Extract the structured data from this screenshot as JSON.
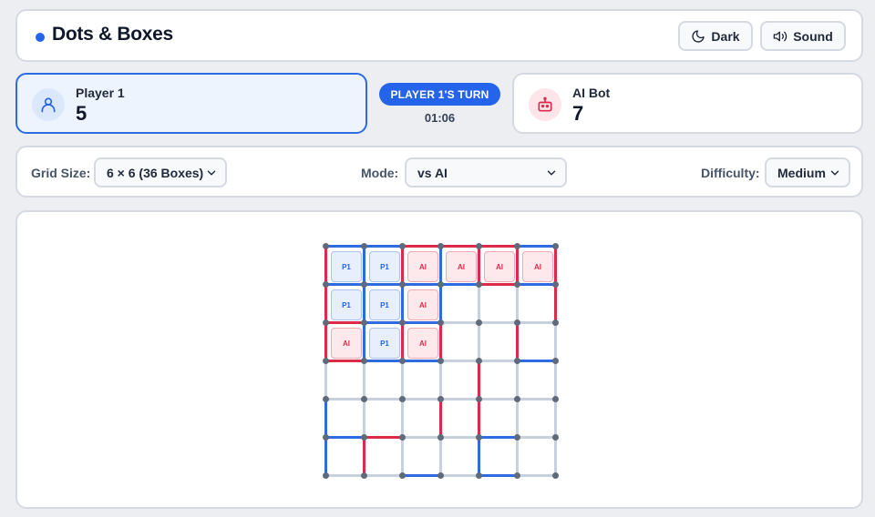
{
  "header": {
    "title": "Dots & Boxes",
    "dark_label": "Dark",
    "sound_label": "Sound"
  },
  "players": {
    "p1": {
      "name": "Player 1",
      "score": "5",
      "icon": "user-icon"
    },
    "p2": {
      "name": "AI Bot",
      "score": "7",
      "icon": "robot-icon"
    }
  },
  "turn": {
    "label": "PLAYER 1'S TURN",
    "timer": "01:06"
  },
  "settings": {
    "grid_size_label": "Grid Size:",
    "grid_size_value": "6 × 6 (36 Boxes)",
    "mode_label": "Mode:",
    "mode_value": "vs AI",
    "difficulty_label": "Difficulty:",
    "difficulty_value": "Medium"
  },
  "colors": {
    "player1": "#2f6be0",
    "ai": "#dd2a48",
    "empty": "#c7d0dc",
    "accent": "#2563eb"
  },
  "board": {
    "size": 6,
    "boxes": [
      [
        "P1",
        "P1",
        "AI",
        "AI",
        "AI",
        "AI"
      ],
      [
        "P1",
        "P1",
        "AI",
        "",
        "",
        ""
      ],
      [
        "AI",
        "P1",
        "AI",
        "",
        "",
        ""
      ],
      [
        "",
        "",
        "",
        "",
        "",
        ""
      ],
      [
        "",
        "",
        "",
        "",
        "",
        ""
      ],
      [
        "",
        "",
        "",
        "",
        "",
        ""
      ]
    ],
    "h_lines": [
      [
        "p1",
        "p1",
        "ai",
        "ai",
        "ai",
        "p1"
      ],
      [
        "p1",
        "p1",
        "p1",
        "p1",
        "ai",
        "p1"
      ],
      [
        "ai",
        "p1",
        "p1",
        "",
        "",
        ""
      ],
      [
        "ai",
        "p1",
        "p1",
        "",
        "",
        "p1"
      ],
      [
        "",
        "",
        "",
        "",
        "",
        ""
      ],
      [
        "p1",
        "ai",
        "",
        "",
        "p1",
        ""
      ],
      [
        "",
        "",
        "p1",
        "",
        "p1",
        ""
      ]
    ],
    "v_lines": [
      [
        "ai",
        "p1",
        "ai",
        "p1",
        "ai",
        "ai",
        "ai"
      ],
      [
        "ai",
        "p1",
        "p1",
        "p1",
        "",
        "",
        "ai"
      ],
      [
        "ai",
        "p1",
        "ai",
        "ai",
        "",
        "ai",
        ""
      ],
      [
        "",
        "",
        "",
        "",
        "ai",
        "",
        ""
      ],
      [
        "p1",
        "",
        "",
        "ai",
        "ai",
        "",
        ""
      ],
      [
        "p1",
        "ai",
        "",
        "",
        "p1",
        "",
        ""
      ]
    ]
  }
}
